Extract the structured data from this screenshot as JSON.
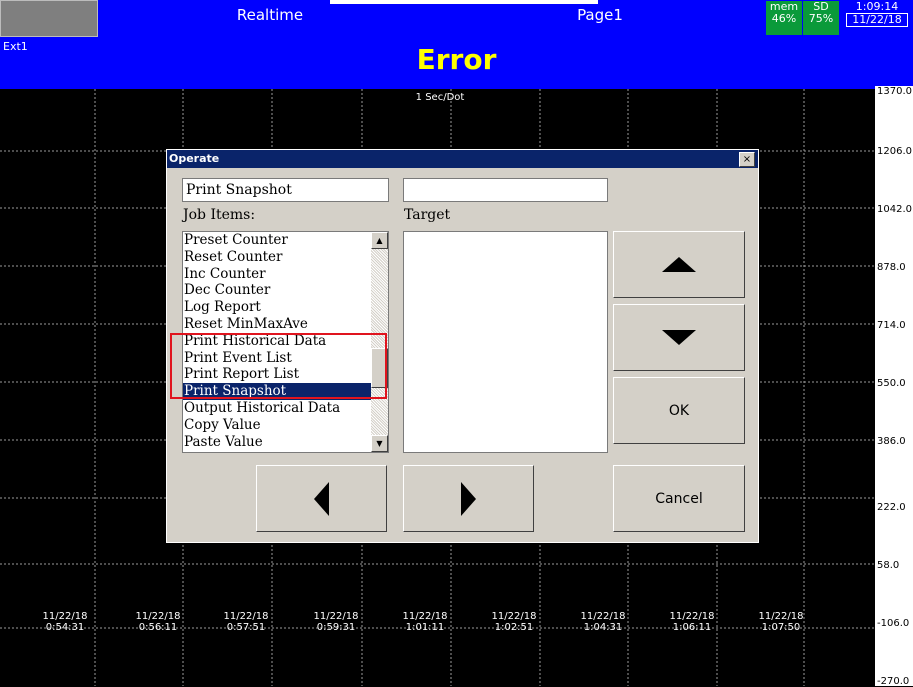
{
  "topbar": {
    "realtime": "Realtime",
    "page": "Page1",
    "mem_label": "mem",
    "mem_value": "46%",
    "sd_label": "SD",
    "sd_value": "75%",
    "time": "1:09:14",
    "date": "11/22/18"
  },
  "header": {
    "ext": "Ext1",
    "error": "Error"
  },
  "chart": {
    "scan_rate": "1 Sec/Dot",
    "scale_ticks": [
      "1370.0",
      "1206.0",
      "1042.0",
      "878.0",
      "714.0",
      "550.0",
      "386.0",
      "222.0",
      "58.0",
      "-106.0",
      "-270.0"
    ],
    "x_labels": [
      {
        "date": "11/22/18",
        "time": "0:54:31"
      },
      {
        "date": "11/22/18",
        "time": "0:56:11"
      },
      {
        "date": "11/22/18",
        "time": "0:57:51"
      },
      {
        "date": "11/22/18",
        "time": "0:59:31"
      },
      {
        "date": "11/22/18",
        "time": "1:01:11"
      },
      {
        "date": "11/22/18",
        "time": "1:02:51"
      },
      {
        "date": "11/22/18",
        "time": "1:04:31"
      },
      {
        "date": "11/22/18",
        "time": "1:06:11"
      },
      {
        "date": "11/22/18",
        "time": "1:07:50"
      }
    ]
  },
  "dialog": {
    "title": "Operate",
    "close": "×",
    "selected_job": "Print Snapshot",
    "target_value": "",
    "job_items_label": "Job Items:",
    "target_label": "Target",
    "items": [
      "Preset Counter",
      "Reset Counter",
      "Inc Counter",
      "Dec Counter",
      "Log Report",
      "Reset MinMaxAve",
      "Print Historical Data",
      "Print Event List",
      "Print Report List",
      "Print Snapshot",
      "Output Historical Data",
      "Copy Value",
      "Paste Value"
    ],
    "selected_index": 9,
    "ok": "OK",
    "cancel": "Cancel"
  }
}
